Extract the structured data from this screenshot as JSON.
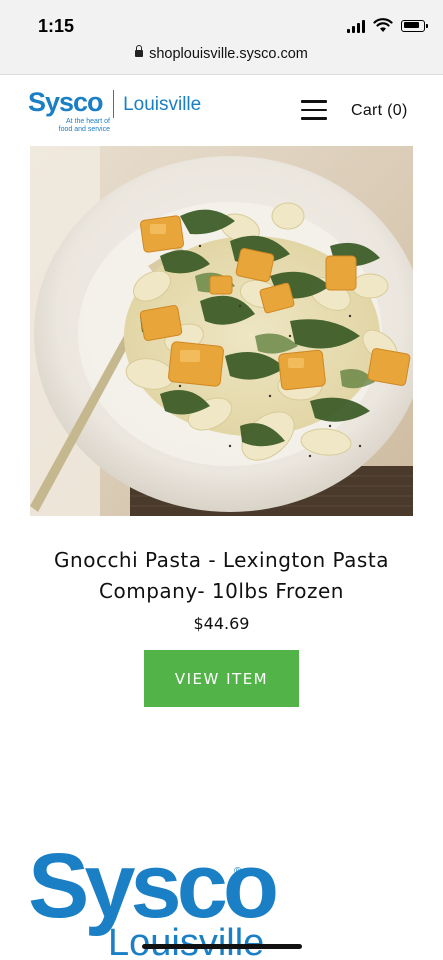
{
  "status_bar": {
    "time": "1:15",
    "url": "shoplouisville.sysco.com"
  },
  "header": {
    "brand_name": "Sysco",
    "brand_tagline": "At the heart of food and service",
    "brand_city": "Louisville",
    "cart_label": "Cart (0)",
    "menu_icon": "hamburger-menu-icon"
  },
  "product": {
    "title_line1": "Gnocchi Pasta - Lexington Pasta",
    "title_line2": "Company- 10lbs Frozen",
    "price": "$44.69",
    "button_label": "VIEW ITEM"
  },
  "footer": {
    "brand_name": "Sysco",
    "brand_reg": "®",
    "brand_city": "Louisville"
  },
  "colors": {
    "brand_blue": "#1a7fc4",
    "button_green": "#52b448"
  }
}
